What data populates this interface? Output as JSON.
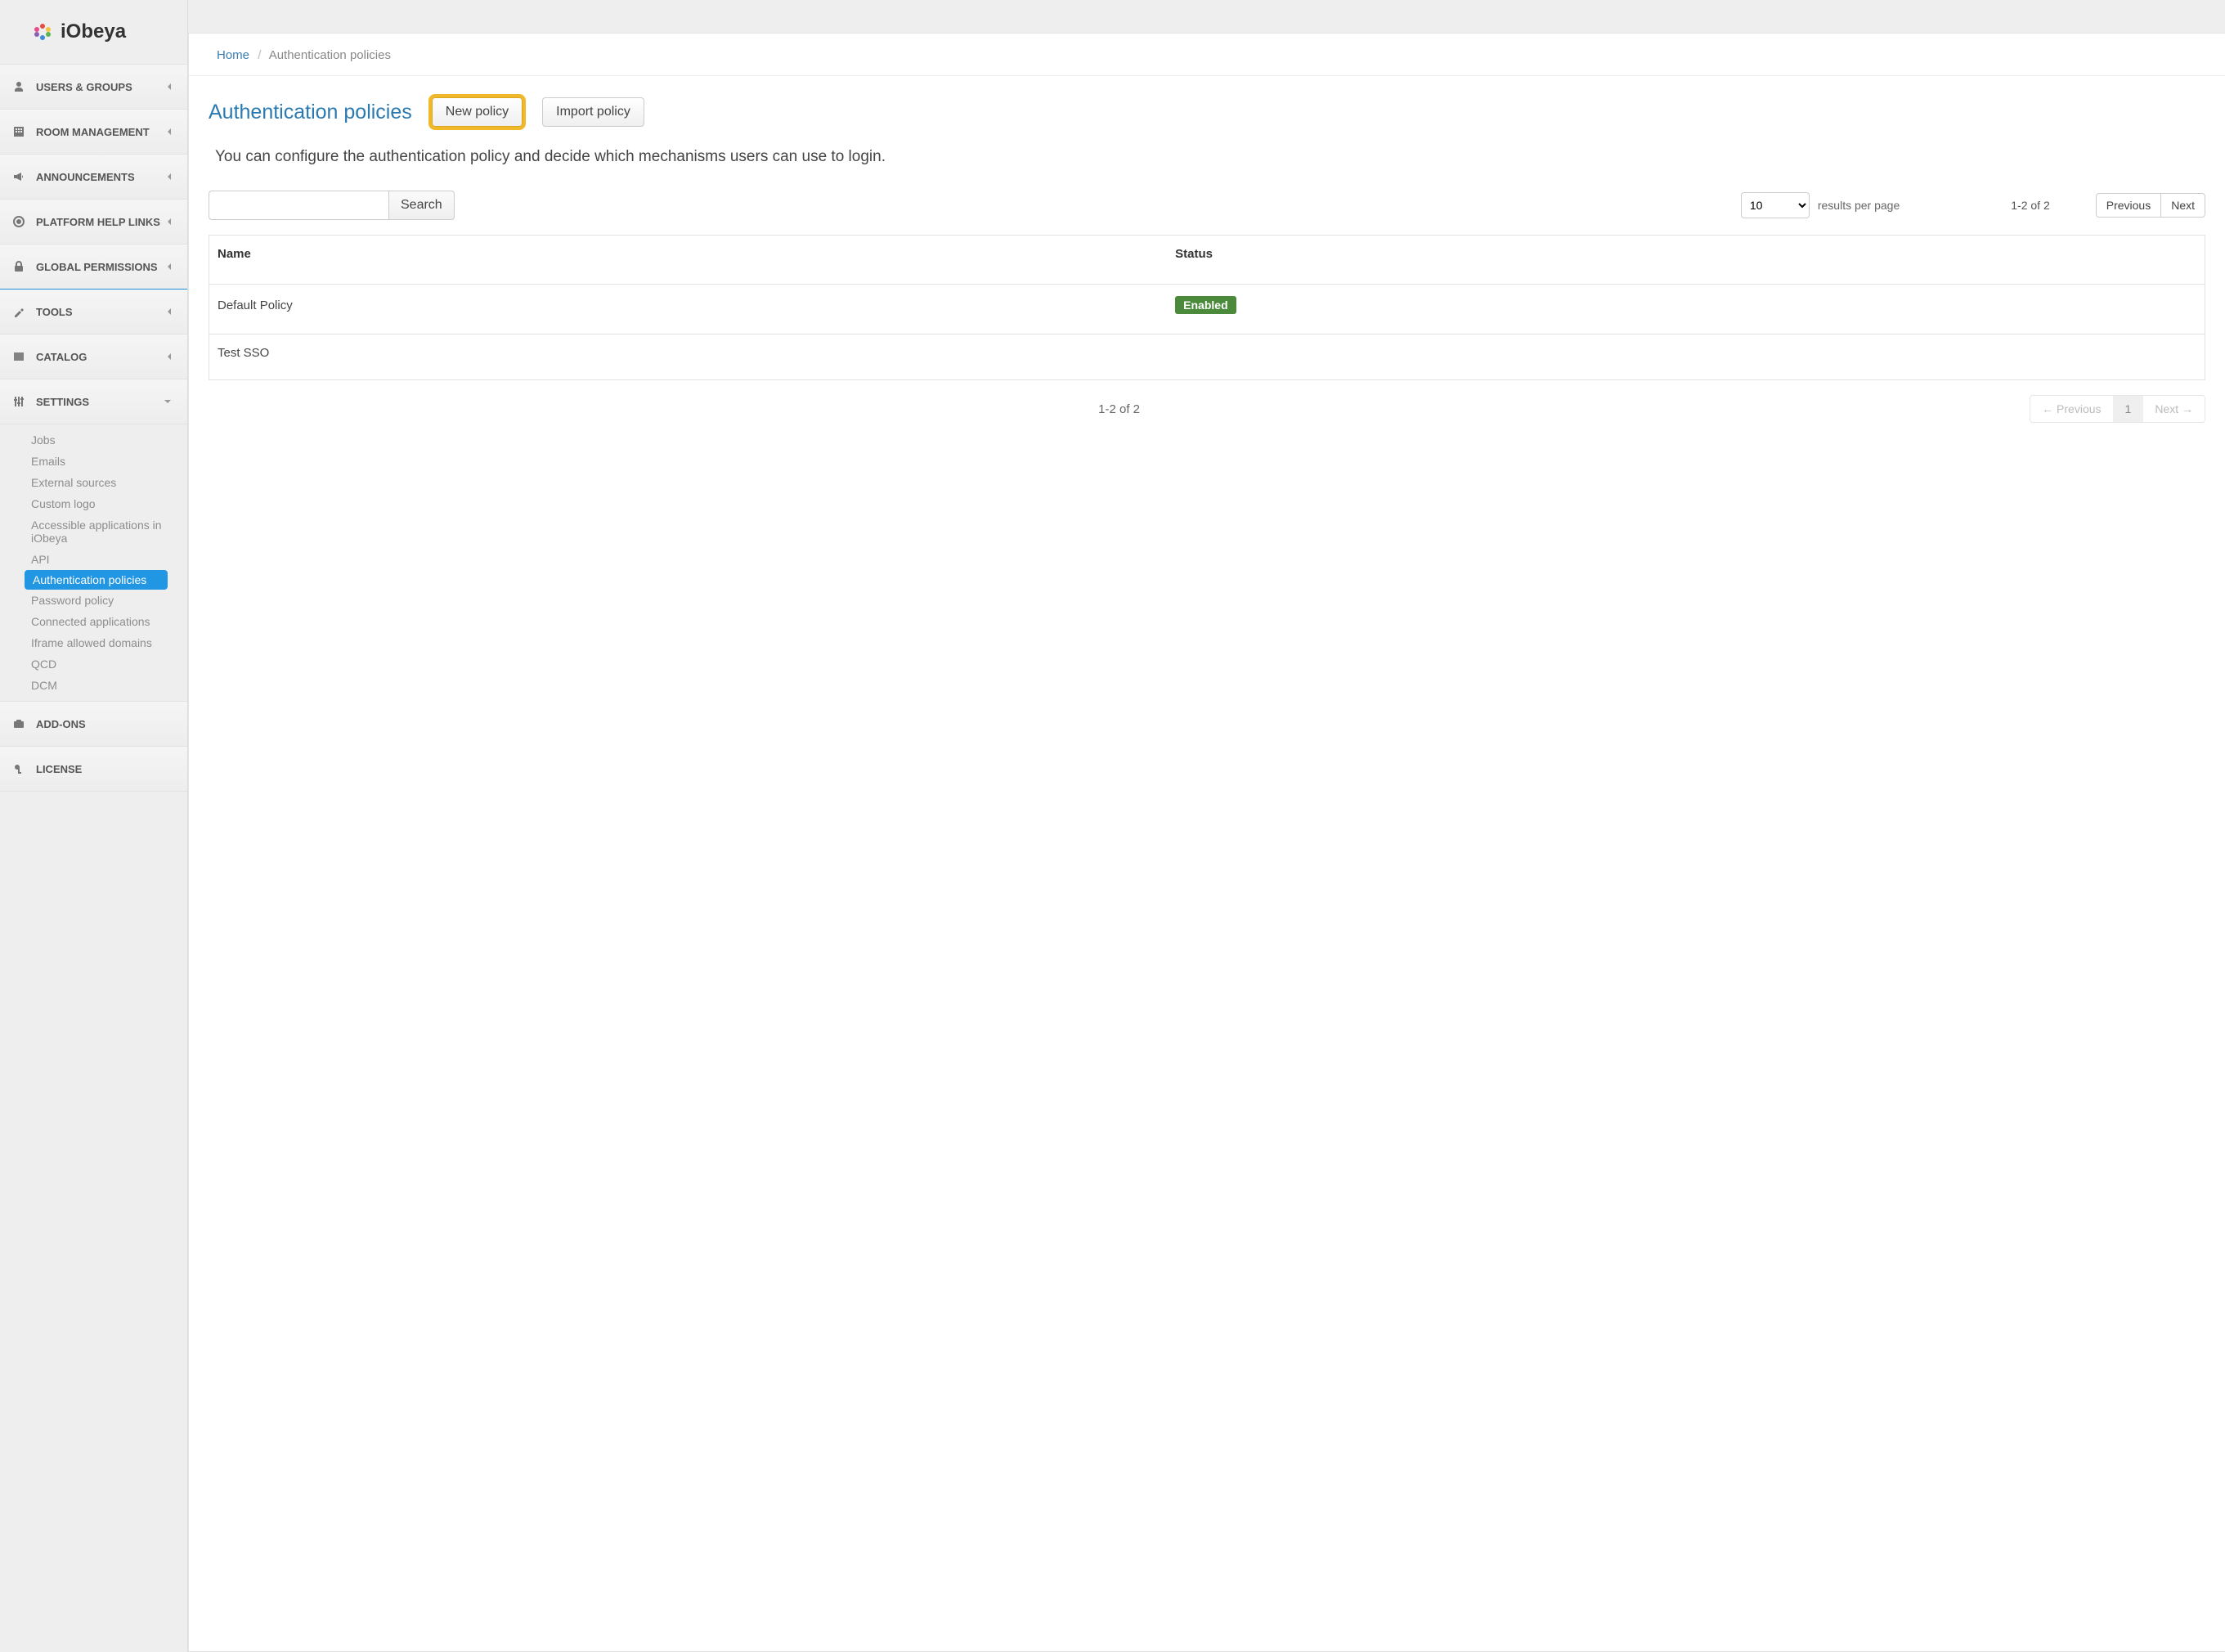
{
  "brand": {
    "name": "iObeya"
  },
  "sidebar": {
    "items": [
      {
        "label": "USERS & GROUPS"
      },
      {
        "label": "ROOM MANAGEMENT"
      },
      {
        "label": "ANNOUNCEMENTS"
      },
      {
        "label": "PLATFORM HELP LINKS"
      },
      {
        "label": "GLOBAL PERMISSIONS"
      },
      {
        "label": "TOOLS"
      },
      {
        "label": "CATALOG"
      },
      {
        "label": "SETTINGS"
      },
      {
        "label": "ADD-ONS"
      },
      {
        "label": "LICENSE"
      }
    ],
    "settings_sub": [
      {
        "label": "Jobs"
      },
      {
        "label": "Emails"
      },
      {
        "label": "External sources"
      },
      {
        "label": "Custom logo"
      },
      {
        "label": "Accessible applications in iObeya"
      },
      {
        "label": "API"
      },
      {
        "label": "Authentication policies"
      },
      {
        "label": "Password policy"
      },
      {
        "label": "Connected applications"
      },
      {
        "label": "Iframe allowed domains"
      },
      {
        "label": "QCD"
      },
      {
        "label": "DCM"
      }
    ]
  },
  "breadcrumb": {
    "home": "Home",
    "current": "Authentication policies"
  },
  "page": {
    "title": "Authentication policies",
    "new_policy": "New policy",
    "import_policy": "Import policy",
    "description": "You can configure the authentication policy and decide which mechanisms users can use to login."
  },
  "controls": {
    "search_label": "Search",
    "results_per_page": "results per page",
    "page_size": "10",
    "range": "1-2 of 2",
    "prev": "Previous",
    "next": "Next"
  },
  "table": {
    "columns": {
      "name": "Name",
      "status": "Status"
    },
    "rows": [
      {
        "name": "Default Policy",
        "status": "Enabled"
      },
      {
        "name": "Test SSO",
        "status": ""
      }
    ]
  },
  "footer": {
    "range": "1-2 of 2",
    "prev": "← Previous",
    "page": "1",
    "next": "Next →"
  }
}
